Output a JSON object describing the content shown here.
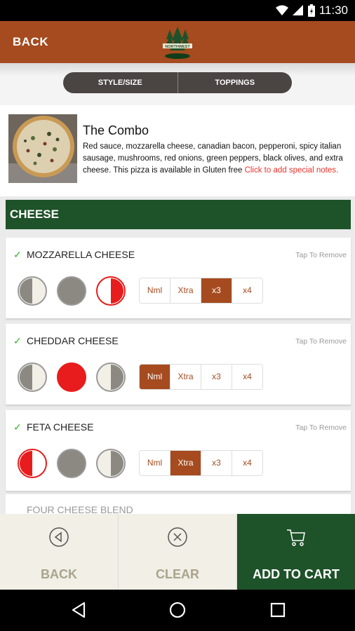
{
  "status_bar": {
    "time": "11:30"
  },
  "app_bar": {
    "back_label": "BACK",
    "logo_text": "NORTHWEST"
  },
  "segments": {
    "style_size": "STYLE/SIZE",
    "toppings": "TOPPINGS"
  },
  "product": {
    "title": "The Combo",
    "description": "Red sauce, mozzarella cheese, canadian bacon, pepperoni, spicy italian sausage, mushrooms, red onions, green peppers, black olives, and extra cheese. This pizza is available in Gluten free",
    "notes_link": "Click to add special notes."
  },
  "section": {
    "title": "CHEESE"
  },
  "toppings": [
    {
      "name": "MOZZARELLA CHEESE",
      "tap_label": "Tap To Remove",
      "amounts": [
        "Nml",
        "Xtra",
        "x3",
        "x4"
      ],
      "selected_amount": "x3",
      "selected_side": "right"
    },
    {
      "name": "CHEDDAR CHEESE",
      "tap_label": "Tap To Remove",
      "amounts": [
        "Nml",
        "Xtra",
        "x3",
        "x4"
      ],
      "selected_amount": "Nml",
      "selected_side": "whole"
    },
    {
      "name": "FETA CHEESE",
      "tap_label": "Tap To Remove",
      "amounts": [
        "Nml",
        "Xtra",
        "x3",
        "x4"
      ],
      "selected_amount": "Xtra",
      "selected_side": "left"
    }
  ],
  "partial_item": {
    "name": "FOUR CHEESE BLEND"
  },
  "bottom_bar": {
    "back": "BACK",
    "clear": "CLEAR",
    "add_to_cart": "ADD TO CART"
  },
  "colors": {
    "brand": "#a54b1f",
    "green": "#1e5229",
    "selected_red": "#e81c1c",
    "check": "#2eb82e"
  }
}
